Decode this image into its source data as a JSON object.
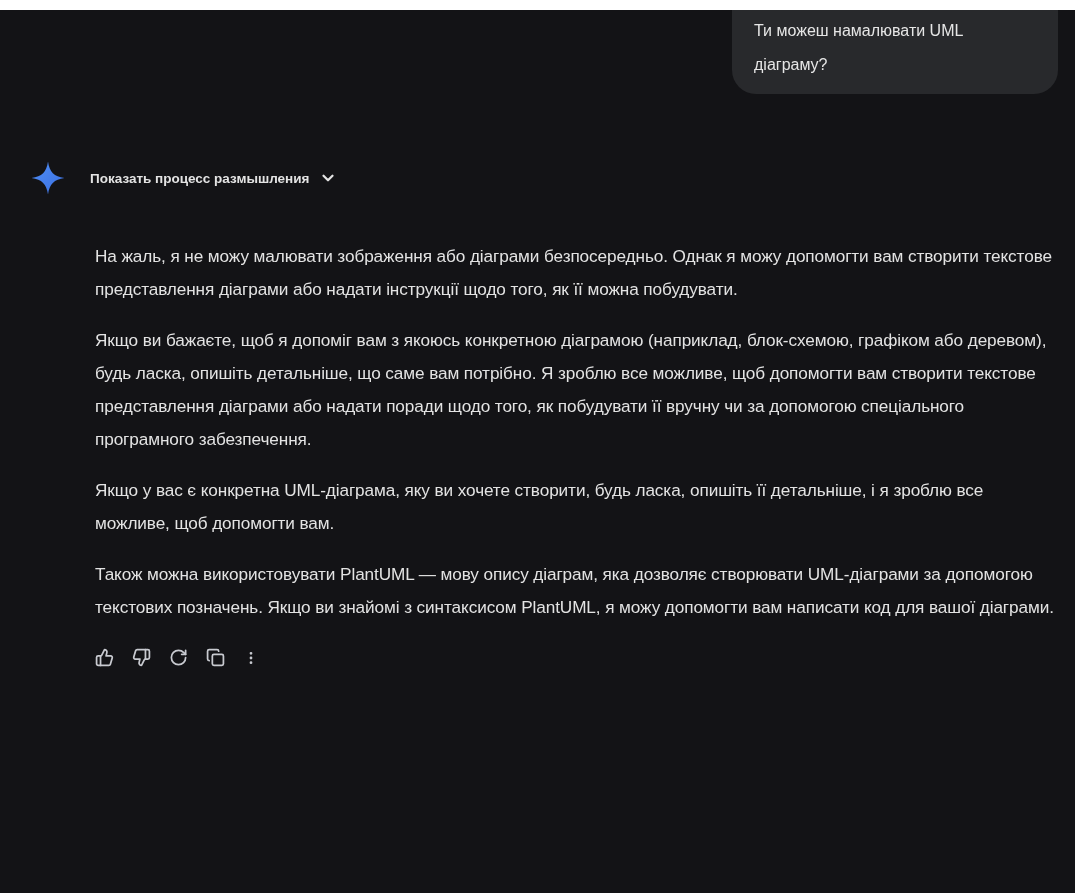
{
  "user_message": {
    "text": "Ти можеш намалювати UML діаграму?"
  },
  "thinking_toggle": {
    "label": "Показать процесс размышления",
    "expanded": false
  },
  "response": {
    "paragraphs": [
      "На жаль, я не можу малювати зображення або діаграми безпосередньо. Однак я можу допомогти вам створити текстове представлення діаграми або надати інструкції щодо того, як її можна побудувати.",
      "Якщо ви бажаєте, щоб я допоміг вам з якоюсь конкретною діаграмою (наприклад, блок-схемою, графіком або деревом), будь ласка, опишіть детальніше, що саме вам потрібно. Я зроблю все можливе, щоб допомогти вам створити текстове представлення діаграми або надати поради щодо того, як побудувати її вручну чи за допомогою спеціального програмного забезпечення.",
      "Якщо у вас є конкретна UML-діаграма, яку ви хочете створити, будь ласка, опишіть її детальніше, і я зроблю все можливе, щоб допомогти вам.",
      "Також можна використовувати PlantUML — мову опису діаграм, яка дозволяє створювати UML-діаграми за допомогою текстових позначень. Якщо ви знайомі з синтаксисом PlantUML, я можу допомогти вам написати код для вашої діаграми."
    ]
  },
  "actions": [
    {
      "kind": "like"
    },
    {
      "kind": "dislike"
    },
    {
      "kind": "regenerate"
    },
    {
      "kind": "copy"
    },
    {
      "kind": "more"
    }
  ]
}
